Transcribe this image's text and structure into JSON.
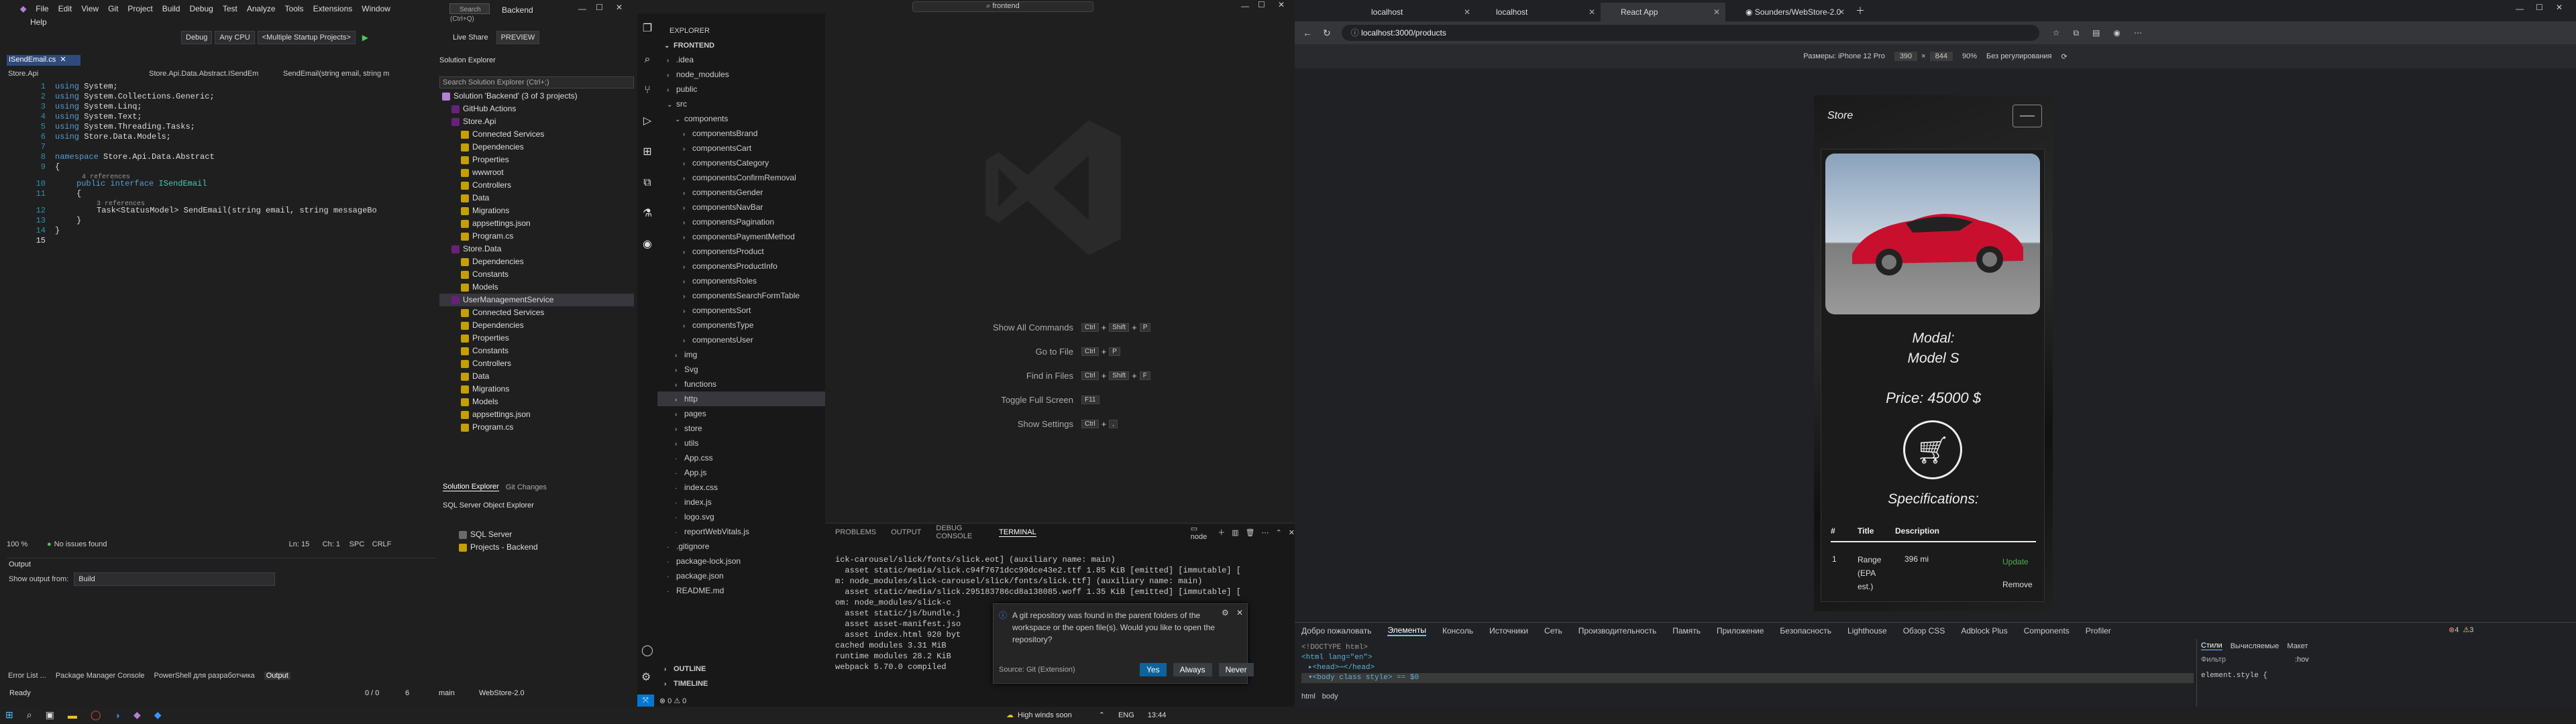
{
  "vs": {
    "menu": [
      "File",
      "Edit",
      "View",
      "Git",
      "Project",
      "Build",
      "Debug",
      "Test",
      "Analyze",
      "Tools",
      "Extensions",
      "Window",
      "Help"
    ],
    "search_placeholder": "Search (Ctrl+Q)",
    "solution_name": "Backend",
    "toolbar": {
      "config": "Debug",
      "platform": "Any CPU",
      "startup": "<Multiple Startup Projects>",
      "live_share": "Live Share",
      "preview": "PREVIEW"
    },
    "tab": "ISendEmail.cs",
    "nav": [
      "Store.Api",
      "Store.Api.Data.Abstract.ISendEm",
      "SendEmail(string email, string m"
    ],
    "code": {
      "l1": "System;",
      "l2": "System.Collections.Generic;",
      "l3": "System.Linq;",
      "l4": "System.Text;",
      "l5": "System.Threading.Tasks;",
      "l6": "Store.Data.Models;",
      "using": "using",
      "namespace_kw": "namespace",
      "namespace": "Store.Api.Data.Abstract",
      "refs4": "4 references",
      "public": "public",
      "interface": "interface",
      "iname": "ISendEmail",
      "refs3": "3 references",
      "method": "Task<StatusModel> SendEmail(string email, string messageBo"
    },
    "status": {
      "zoom": "100 %",
      "issues": "No issues found",
      "ln": "Ln: 15",
      "ch": "Ch: 1",
      "spc": "SPC",
      "crlf": "CRLF",
      "ready": "Ready",
      "changes": "0 / 0",
      "pending": "6",
      "branch": "main",
      "repo": "WebStore-2.0"
    },
    "output": {
      "title": "Output",
      "show_from": "Show output from:",
      "source": "Build"
    },
    "bottom_tabs": [
      "Error List ...",
      "Package Manager Console",
      "PowerShell для разработчика",
      "Output"
    ],
    "se": {
      "title": "Solution Explorer",
      "search": "Search Solution Explorer (Ctrl+;)",
      "items": [
        {
          "t": "Solution 'Backend' (3 of 3 projects)",
          "d": 0
        },
        {
          "t": "GitHub Actions",
          "d": 1
        },
        {
          "t": "Store.Api",
          "d": 1
        },
        {
          "t": "Connected Services",
          "d": 2
        },
        {
          "t": "Dependencies",
          "d": 2
        },
        {
          "t": "Properties",
          "d": 2
        },
        {
          "t": "wwwroot",
          "d": 2
        },
        {
          "t": "Controllers",
          "d": 2
        },
        {
          "t": "Data",
          "d": 2
        },
        {
          "t": "Migrations",
          "d": 2
        },
        {
          "t": "appsettings.json",
          "d": 2
        },
        {
          "t": "Program.cs",
          "d": 2
        },
        {
          "t": "Store.Data",
          "d": 1
        },
        {
          "t": "Dependencies",
          "d": 2
        },
        {
          "t": "Constants",
          "d": 2
        },
        {
          "t": "Models",
          "d": 2
        },
        {
          "t": "UserManagementService",
          "d": 1
        },
        {
          "t": "Connected Services",
          "d": 2
        },
        {
          "t": "Dependencies",
          "d": 2
        },
        {
          "t": "Properties",
          "d": 2
        },
        {
          "t": "Constants",
          "d": 2
        },
        {
          "t": "Controllers",
          "d": 2
        },
        {
          "t": "Data",
          "d": 2
        },
        {
          "t": "Migrations",
          "d": 2
        },
        {
          "t": "Models",
          "d": 2
        },
        {
          "t": "appsettings.json",
          "d": 2
        },
        {
          "t": "Program.cs",
          "d": 2
        }
      ],
      "tabs": [
        "Solution Explorer",
        "Git Changes"
      ],
      "sql_title": "SQL Server Object Explorer",
      "sql_items": [
        "SQL Server",
        "Projects - Backend"
      ]
    }
  },
  "vsc": {
    "search": "frontend",
    "explorer": "EXPLORER",
    "root": "FRONTEND",
    "tree": [
      {
        "t": ".idea",
        "d": 0,
        "f": 1
      },
      {
        "t": "node_modules",
        "d": 0,
        "f": 1
      },
      {
        "t": "public",
        "d": 0,
        "f": 1
      },
      {
        "t": "src",
        "d": 0,
        "f": 1,
        "o": 1
      },
      {
        "t": "components",
        "d": 1,
        "f": 1,
        "o": 1
      },
      {
        "t": "componentsBrand",
        "d": 2,
        "f": 1
      },
      {
        "t": "componentsCart",
        "d": 2,
        "f": 1
      },
      {
        "t": "componentsCategory",
        "d": 2,
        "f": 1
      },
      {
        "t": "componentsConfirmRemoval",
        "d": 2,
        "f": 1
      },
      {
        "t": "componentsGender",
        "d": 2,
        "f": 1
      },
      {
        "t": "componentsNavBar",
        "d": 2,
        "f": 1
      },
      {
        "t": "componentsPagination",
        "d": 2,
        "f": 1
      },
      {
        "t": "componentsPaymentMethod",
        "d": 2,
        "f": 1
      },
      {
        "t": "componentsProduct",
        "d": 2,
        "f": 1
      },
      {
        "t": "componentsProductInfo",
        "d": 2,
        "f": 1
      },
      {
        "t": "componentsRoles",
        "d": 2,
        "f": 1
      },
      {
        "t": "componentsSearchFormTable",
        "d": 2,
        "f": 1
      },
      {
        "t": "componentsSort",
        "d": 2,
        "f": 1
      },
      {
        "t": "componentsType",
        "d": 2,
        "f": 1
      },
      {
        "t": "componentsUser",
        "d": 2,
        "f": 1
      },
      {
        "t": "img",
        "d": 1,
        "f": 1
      },
      {
        "t": "Svg",
        "d": 1,
        "f": 1
      },
      {
        "t": "functions",
        "d": 1,
        "f": 1
      },
      {
        "t": "http",
        "d": 1,
        "f": 1,
        "sel": 1
      },
      {
        "t": "pages",
        "d": 1,
        "f": 1
      },
      {
        "t": "store",
        "d": 1,
        "f": 1
      },
      {
        "t": "utils",
        "d": 1,
        "f": 1
      },
      {
        "t": "App.css",
        "d": 1
      },
      {
        "t": "App.js",
        "d": 1
      },
      {
        "t": "index.css",
        "d": 1
      },
      {
        "t": "index.js",
        "d": 1
      },
      {
        "t": "logo.svg",
        "d": 1
      },
      {
        "t": "reportWebVitals.js",
        "d": 1
      },
      {
        "t": ".gitignore",
        "d": 0
      },
      {
        "t": "package-lock.json",
        "d": 0
      },
      {
        "t": "package.json",
        "d": 0
      },
      {
        "t": "README.md",
        "d": 0
      }
    ],
    "outline": "OUTLINE",
    "timeline": "TIMELINE",
    "shortcuts": [
      {
        "l": "Show All Commands",
        "k": [
          "Ctrl",
          "+",
          "Shift",
          "+",
          "P"
        ]
      },
      {
        "l": "Go to File",
        "k": [
          "Ctrl",
          "+",
          "P"
        ]
      },
      {
        "l": "Find in Files",
        "k": [
          "Ctrl",
          "+",
          "Shift",
          "+",
          "F"
        ]
      },
      {
        "l": "Toggle Full Screen",
        "k": [
          "F11"
        ]
      },
      {
        "l": "Show Settings",
        "k": [
          "Ctrl",
          "+",
          ","
        ]
      }
    ],
    "panel_tabs": [
      "PROBLEMS",
      "OUTPUT",
      "DEBUG CONSOLE",
      "TERMINAL"
    ],
    "terminal_name": "node",
    "terminal": [
      "ick-carousel/slick/fonts/slick.eot] (auxiliary name: main)",
      "  asset static/media/slick.c94f7671dcc99dce43e2.ttf 1.85 KiB [emitted] [immutable] [fro",
      "m: node_modules/slick-carousel/slick/fonts/slick.ttf] (auxiliary name: main)",
      "  asset static/media/slick.295183786cd8a138085.woff 1.35 KiB [emitted] [immutable] [fr",
      "om: node_modules/slick-c",
      "  asset static/js/bundle.j",
      "  asset asset-manifest.jso",
      "  asset index.html 920 byt",
      "cached modules 3.31 MiB",
      "runtime modules 28.2 KiB",
      "webpack 5.70.0 compiled"
    ],
    "notif": {
      "msg": "A git repository was found in the parent folders of the workspace or the open file(s). Would you like to open the repository?",
      "source": "Source: Git (Extension)",
      "yes": "Yes",
      "always": "Always",
      "never": "Never"
    },
    "status": {
      "left": "⊗ 0 ⚠ 0"
    }
  },
  "browser": {
    "tabs": [
      "localhost",
      "localhost",
      "React App",
      "Sounders/WebStore-2.0"
    ],
    "url": "localhost:3000/products",
    "device": {
      "label": "Размеры: iPhone 12 Pro",
      "w": "390",
      "h": "844",
      "zoom": "90%",
      "throttle": "Без регулирования"
    },
    "phone": {
      "brand": "Store",
      "modal": "Modal:",
      "model": "Model S",
      "price": "Price: 45000 $",
      "spec": "Specifications:",
      "th": [
        "#",
        "Title",
        "Description"
      ],
      "row": {
        "n": "1",
        "title": "Range (EPA est.)",
        "desc": "396 mi",
        "update": "Update",
        "remove": "Remove"
      }
    },
    "devtools": {
      "tabs": [
        "Добро пожаловать",
        "Элементы",
        "Консоль",
        "Источники",
        "Сеть",
        "Производительность",
        "Память",
        "Приложение",
        "Безопасность",
        "Lighthouse",
        "Обзор CSS",
        "Adblock Plus",
        "Components",
        "Profiler"
      ],
      "errors": "4",
      "warns": "3",
      "dom": [
        "<!DOCTYPE html>",
        "<html lang=\"en\">",
        "▸<head>⋯</head>",
        "▾<body class style> == $0"
      ],
      "breadcrumb": [
        "html",
        "body"
      ],
      "styles_tabs": [
        "Стили",
        "Вычисляемые",
        "Макет"
      ],
      "filter": "Фильтр",
      ":hov": ":hov",
      ".cls": ".cls",
      "style": "element.style {"
    }
  },
  "taskbar": {
    "weather": "High winds soon",
    "lang": "ENG",
    "time": "13:44"
  }
}
